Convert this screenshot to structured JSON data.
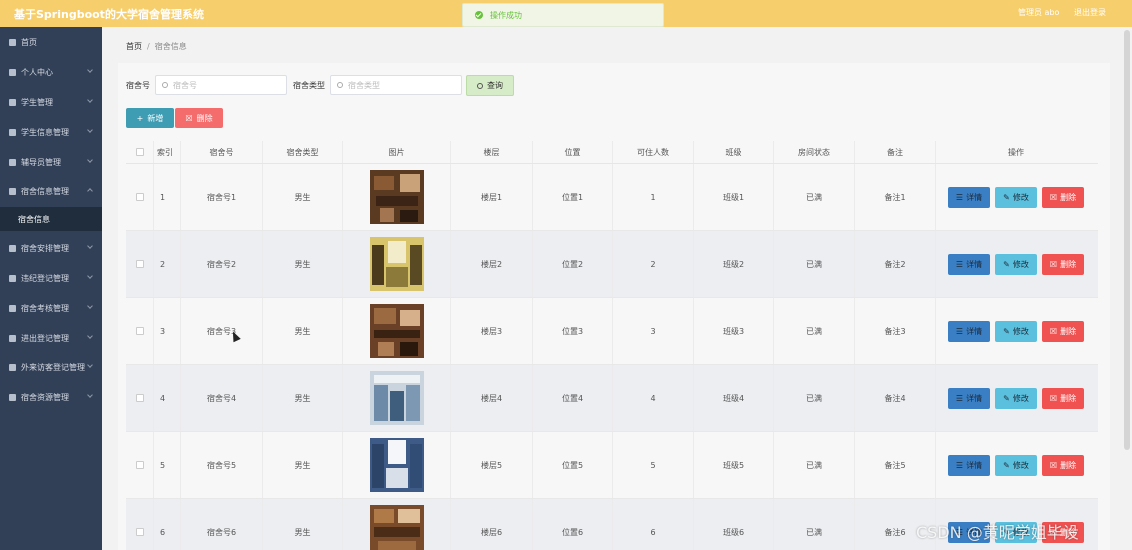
{
  "header": {
    "title": "基于Springboot的大学宿舍管理系统",
    "toast": "操作成功",
    "user": "管理员 abo",
    "logout": "退出登录"
  },
  "sidebar": {
    "items": [
      {
        "label": "首页",
        "icon": "home-icon"
      },
      {
        "label": "个人中心",
        "icon": "user-icon"
      },
      {
        "label": "学生管理",
        "icon": "menu-icon"
      },
      {
        "label": "学生信息管理",
        "icon": "menu-icon"
      },
      {
        "label": "辅导员管理",
        "icon": "menu-icon"
      },
      {
        "label": "宿舍信息管理",
        "icon": "gear-icon"
      },
      {
        "label": "宿舍安排管理",
        "icon": "menu-icon"
      },
      {
        "label": "违纪登记管理",
        "icon": "chart-icon"
      },
      {
        "label": "宿舍考核管理",
        "icon": "menu-icon"
      },
      {
        "label": "进出登记管理",
        "icon": "gear-icon"
      },
      {
        "label": "外来访客登记管理",
        "icon": "send-icon"
      },
      {
        "label": "宿舍资源管理",
        "icon": "location-icon"
      }
    ],
    "active_sub": "宿舍信息"
  },
  "breadcrumb": {
    "home": "首页",
    "sep": "/",
    "current": "宿舍信息"
  },
  "search": {
    "field1_label": "宿舍号",
    "field1_placeholder": "宿舍号",
    "field2_label": "宿舍类型",
    "field2_placeholder": "宿舍类型",
    "query_label": "查询"
  },
  "actions": {
    "add_label": "新增",
    "delete_label": "删除"
  },
  "table": {
    "columns": [
      "索引",
      "宿舍号",
      "宿舍类型",
      "图片",
      "楼层",
      "位置",
      "可住人数",
      "班级",
      "房间状态",
      "备注",
      "操作"
    ],
    "rows": [
      {
        "index": "1",
        "room": "宿舍号1",
        "type": "男生",
        "floor": "楼层1",
        "position": "位置1",
        "capacity": "1",
        "class": "班级1",
        "status": "已满",
        "note": "备注1"
      },
      {
        "index": "2",
        "room": "宿舍号2",
        "type": "男生",
        "floor": "楼层2",
        "position": "位置2",
        "capacity": "2",
        "class": "班级2",
        "status": "已满",
        "note": "备注2"
      },
      {
        "index": "3",
        "room": "宿舍号3",
        "type": "男生",
        "floor": "楼层3",
        "position": "位置3",
        "capacity": "3",
        "class": "班级3",
        "status": "已满",
        "note": "备注3"
      },
      {
        "index": "4",
        "room": "宿舍号4",
        "type": "男生",
        "floor": "楼层4",
        "position": "位置4",
        "capacity": "4",
        "class": "班级4",
        "status": "已满",
        "note": "备注4"
      },
      {
        "index": "5",
        "room": "宿舍号5",
        "type": "男生",
        "floor": "楼层5",
        "position": "位置5",
        "capacity": "5",
        "class": "班级5",
        "status": "已满",
        "note": "备注5"
      },
      {
        "index": "6",
        "room": "宿舍号6",
        "type": "男生",
        "floor": "楼层6",
        "position": "位置6",
        "capacity": "6",
        "class": "班级6",
        "status": "已满",
        "note": "备注6"
      }
    ],
    "op_detail": "详情",
    "op_edit": "修改",
    "op_delete": "删除"
  },
  "watermark": "CSDN @黄昵学姐毕设",
  "colors": {
    "header": "#f7ce6c",
    "sidebar": "#324057",
    "accent": "#3f9db3",
    "danger": "#f56c6c"
  }
}
